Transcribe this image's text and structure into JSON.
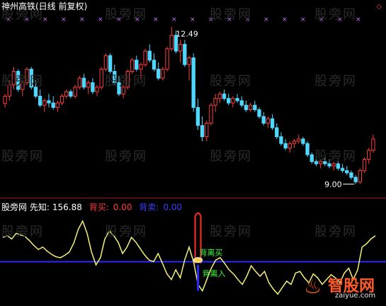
{
  "header": {
    "title": "神州高铁(日线 前复权)",
    "corner_symbol": "◇"
  },
  "watermark": "股旁网",
  "price_chart": {
    "high_label": "12.49",
    "low_label": "9.00",
    "colors": {
      "up": "#ff3d3d",
      "down": "#4fd8ff",
      "marker": "#d070ff"
    }
  },
  "indicator": {
    "name": "股旁网 先知:",
    "value": "156.88",
    "buy_label": "背买:",
    "buy_value": "0.00",
    "sell_label": "背卖:",
    "sell_value": "0.00",
    "colors": {
      "name": "#ffffff",
      "value": "#ffffff",
      "buy": "#ff3d3d",
      "sell": "#3d3dff",
      "line": "#f5f07a",
      "baseline": "#2a2aff"
    },
    "annotations": {
      "divergence_buy": "背离买",
      "divergence_entry": "背离入"
    }
  },
  "logo": {
    "name": "智股网",
    "url": "zaiyue.com"
  },
  "chart_data": {
    "type": "candlestick",
    "ylim": [
      8.8,
      12.8
    ],
    "max_price": 12.49,
    "min_price": 9.0,
    "candles": [
      [
        10.79,
        11.0,
        10.7,
        10.95
      ],
      [
        10.95,
        11.3,
        10.85,
        11.2
      ],
      [
        11.2,
        11.6,
        11.1,
        11.5
      ],
      [
        11.5,
        11.55,
        11.05,
        11.1
      ],
      [
        11.1,
        11.3,
        10.95,
        11.25
      ],
      [
        11.25,
        11.6,
        11.2,
        11.55
      ],
      [
        11.55,
        11.6,
        11.1,
        11.15
      ],
      [
        11.15,
        11.3,
        10.9,
        10.95
      ],
      [
        10.95,
        11.1,
        10.7,
        10.75
      ],
      [
        10.75,
        10.9,
        10.6,
        10.85
      ],
      [
        10.85,
        11.0,
        10.7,
        10.8
      ],
      [
        10.8,
        10.95,
        10.65,
        10.7
      ],
      [
        10.7,
        10.85,
        10.6,
        10.8
      ],
      [
        10.8,
        11.0,
        10.75,
        10.95
      ],
      [
        10.95,
        11.1,
        10.9,
        11.05
      ],
      [
        11.05,
        11.1,
        10.9,
        10.95
      ],
      [
        10.95,
        11.2,
        10.9,
        11.15
      ],
      [
        11.15,
        11.4,
        11.1,
        11.35
      ],
      [
        11.35,
        11.45,
        11.1,
        11.15
      ],
      [
        11.15,
        11.3,
        11.0,
        11.25
      ],
      [
        11.25,
        11.35,
        11.0,
        11.05
      ],
      [
        11.05,
        11.2,
        10.95,
        11.15
      ],
      [
        11.15,
        11.6,
        11.1,
        11.55
      ],
      [
        11.55,
        11.9,
        11.5,
        11.85
      ],
      [
        11.85,
        11.9,
        11.45,
        11.5
      ],
      [
        11.5,
        11.65,
        11.2,
        11.25
      ],
      [
        11.25,
        11.4,
        10.95,
        11.0
      ],
      [
        11.0,
        11.2,
        10.9,
        11.15
      ],
      [
        11.15,
        11.55,
        11.1,
        11.5
      ],
      [
        11.5,
        11.8,
        11.45,
        11.75
      ],
      [
        11.75,
        11.85,
        11.5,
        11.55
      ],
      [
        11.55,
        11.7,
        11.35,
        11.65
      ],
      [
        11.65,
        12.0,
        11.6,
        11.95
      ],
      [
        11.95,
        12.1,
        11.7,
        11.75
      ],
      [
        11.75,
        11.9,
        11.5,
        11.55
      ],
      [
        11.55,
        11.7,
        11.3,
        11.35
      ],
      [
        11.35,
        11.6,
        11.3,
        11.55
      ],
      [
        11.55,
        12.05,
        11.5,
        12.0
      ],
      [
        12.0,
        12.49,
        11.95,
        12.3
      ],
      [
        12.3,
        12.4,
        11.9,
        11.95
      ],
      [
        11.95,
        12.2,
        11.7,
        12.1
      ],
      [
        12.1,
        12.2,
        11.6,
        11.65
      ],
      [
        11.65,
        11.85,
        11.3,
        11.8
      ],
      [
        11.8,
        11.9,
        10.6,
        10.7
      ],
      [
        10.7,
        10.9,
        10.2,
        10.3
      ],
      [
        10.3,
        10.5,
        9.95,
        10.05
      ],
      [
        10.05,
        10.4,
        9.95,
        10.35
      ],
      [
        10.35,
        10.8,
        10.3,
        10.75
      ],
      [
        10.75,
        11.0,
        10.6,
        10.9
      ],
      [
        10.9,
        11.05,
        10.8,
        11.0
      ],
      [
        11.0,
        11.1,
        10.85,
        10.9
      ],
      [
        10.9,
        11.0,
        10.75,
        10.8
      ],
      [
        10.8,
        10.95,
        10.7,
        10.9
      ],
      [
        10.9,
        11.0,
        10.8,
        10.85
      ],
      [
        10.85,
        10.95,
        10.7,
        10.75
      ],
      [
        10.75,
        10.85,
        10.6,
        10.65
      ],
      [
        10.65,
        10.8,
        10.6,
        10.75
      ],
      [
        10.75,
        10.85,
        10.6,
        10.65
      ],
      [
        10.65,
        10.7,
        10.45,
        10.5
      ],
      [
        10.5,
        10.6,
        10.3,
        10.35
      ],
      [
        10.35,
        10.5,
        10.25,
        10.45
      ],
      [
        10.45,
        10.55,
        10.2,
        10.25
      ],
      [
        10.25,
        10.35,
        10.0,
        10.05
      ],
      [
        10.05,
        10.15,
        9.85,
        9.9
      ],
      [
        9.9,
        10.0,
        9.75,
        9.8
      ],
      [
        9.8,
        9.95,
        9.7,
        9.9
      ],
      [
        9.9,
        10.0,
        9.8,
        9.95
      ],
      [
        9.95,
        10.1,
        9.9,
        10.0
      ],
      [
        10.0,
        10.05,
        9.85,
        9.9
      ],
      [
        9.9,
        9.95,
        9.6,
        9.65
      ],
      [
        9.65,
        9.7,
        9.45,
        9.5
      ],
      [
        9.5,
        9.6,
        9.4,
        9.45
      ],
      [
        9.45,
        9.55,
        9.35,
        9.5
      ],
      [
        9.5,
        9.6,
        9.4,
        9.45
      ],
      [
        9.45,
        9.55,
        9.35,
        9.4
      ],
      [
        9.4,
        9.5,
        9.3,
        9.45
      ],
      [
        9.45,
        9.5,
        9.3,
        9.35
      ],
      [
        9.35,
        9.45,
        9.25,
        9.3
      ],
      [
        9.3,
        9.4,
        9.2,
        9.25
      ],
      [
        9.25,
        9.3,
        9.1,
        9.15
      ],
      [
        9.15,
        9.2,
        9.0,
        9.05
      ],
      [
        9.05,
        9.35,
        9.0,
        9.3
      ],
      [
        9.3,
        9.6,
        9.25,
        9.55
      ],
      [
        9.55,
        9.8,
        9.45,
        9.75
      ],
      [
        9.75,
        10.1,
        9.7,
        10.0
      ]
    ],
    "indicator_series": [
      70,
      72,
      68,
      75,
      73,
      71,
      66,
      60,
      55,
      58,
      53,
      49,
      46,
      45,
      48,
      52,
      63,
      80,
      90,
      75,
      52,
      36,
      45,
      68,
      78,
      72,
      64,
      50,
      58,
      70,
      64,
      56,
      48,
      42,
      40,
      50,
      38,
      25,
      18,
      30,
      20,
      42,
      58,
      40,
      12,
      4,
      18,
      32,
      42,
      45,
      38,
      30,
      25,
      18,
      12,
      22,
      35,
      28,
      22,
      28,
      14,
      6,
      0,
      8,
      16,
      12,
      26,
      28,
      20,
      14,
      25,
      20,
      12,
      18,
      24,
      20,
      14,
      26,
      32,
      18,
      30,
      58,
      62,
      68,
      72
    ],
    "indicator_ylim": [
      -5,
      100
    ],
    "indicator_baseline": 40
  }
}
